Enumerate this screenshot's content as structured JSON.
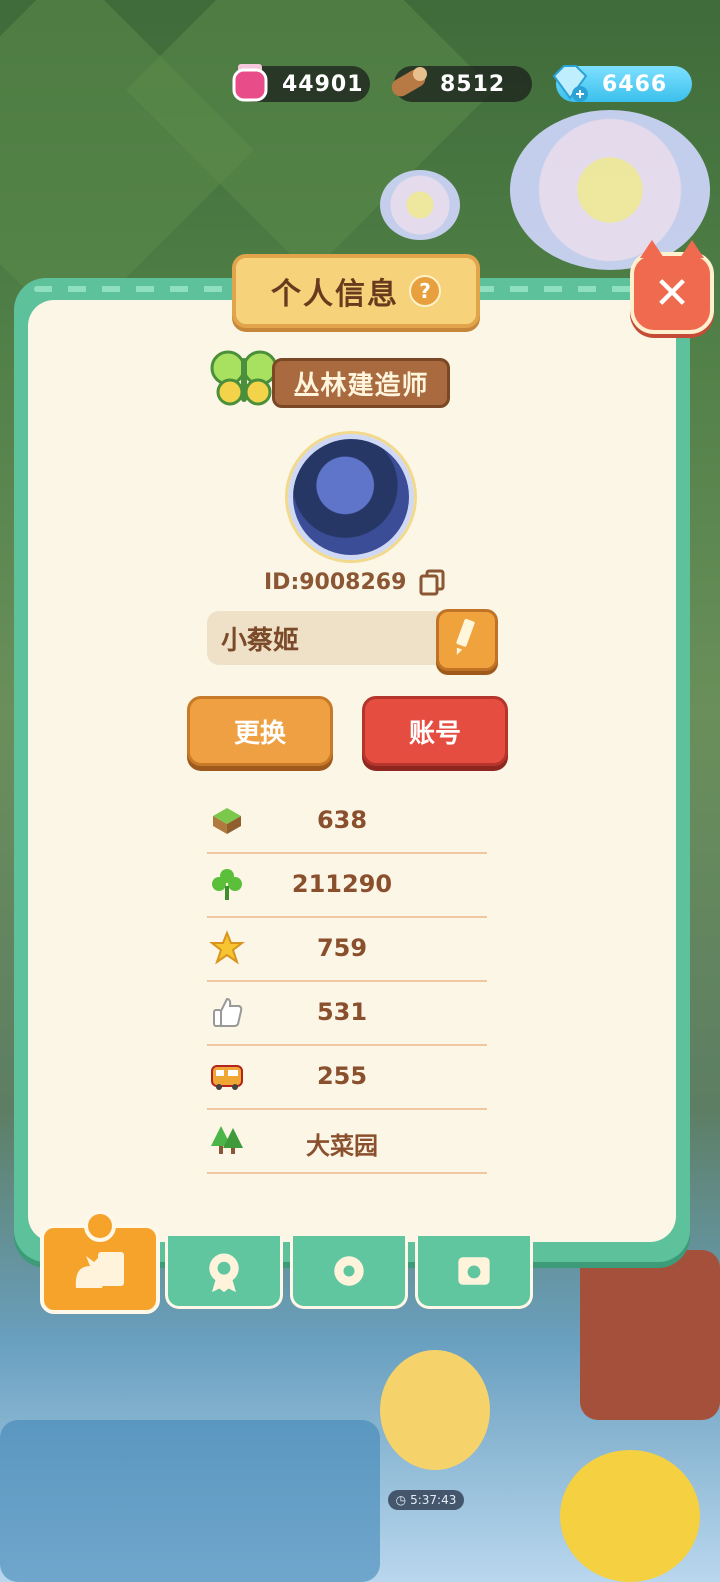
{
  "resources": [
    {
      "icon": "potion-jar-icon",
      "value": "44901"
    },
    {
      "icon": "wood-log-icon",
      "value": "8512"
    },
    {
      "icon": "diamond-icon",
      "value": "6466"
    }
  ],
  "panel": {
    "title": "个人信息",
    "help_icon": "?",
    "close_icon": "✕",
    "badge_text": "丛林建造师",
    "player_id": "ID:9008269",
    "nickname": "小蔡姬",
    "change_button": "更换",
    "account_button": "账号",
    "stats": [
      {
        "icon": "grass-block-icon",
        "value": "638"
      },
      {
        "icon": "clover-icon",
        "value": "211290"
      },
      {
        "icon": "star-icon",
        "value": "759"
      },
      {
        "icon": "thumbs-up-icon",
        "value": "531"
      },
      {
        "icon": "bus-icon",
        "value": "255"
      },
      {
        "icon": "trees-icon",
        "value": "大菜园"
      }
    ]
  },
  "tabs": [
    {
      "name": "profile-card-tab",
      "active": true
    },
    {
      "name": "badge-tab",
      "active": false
    },
    {
      "name": "settings-tab",
      "active": false
    },
    {
      "name": "album-tab",
      "active": false
    }
  ],
  "world_timer": "5:37:43",
  "colors": {
    "panel_green": "#5dc29c",
    "panel_cream": "#fbf6e6",
    "orange": "#eea043",
    "red": "#e64d41"
  }
}
